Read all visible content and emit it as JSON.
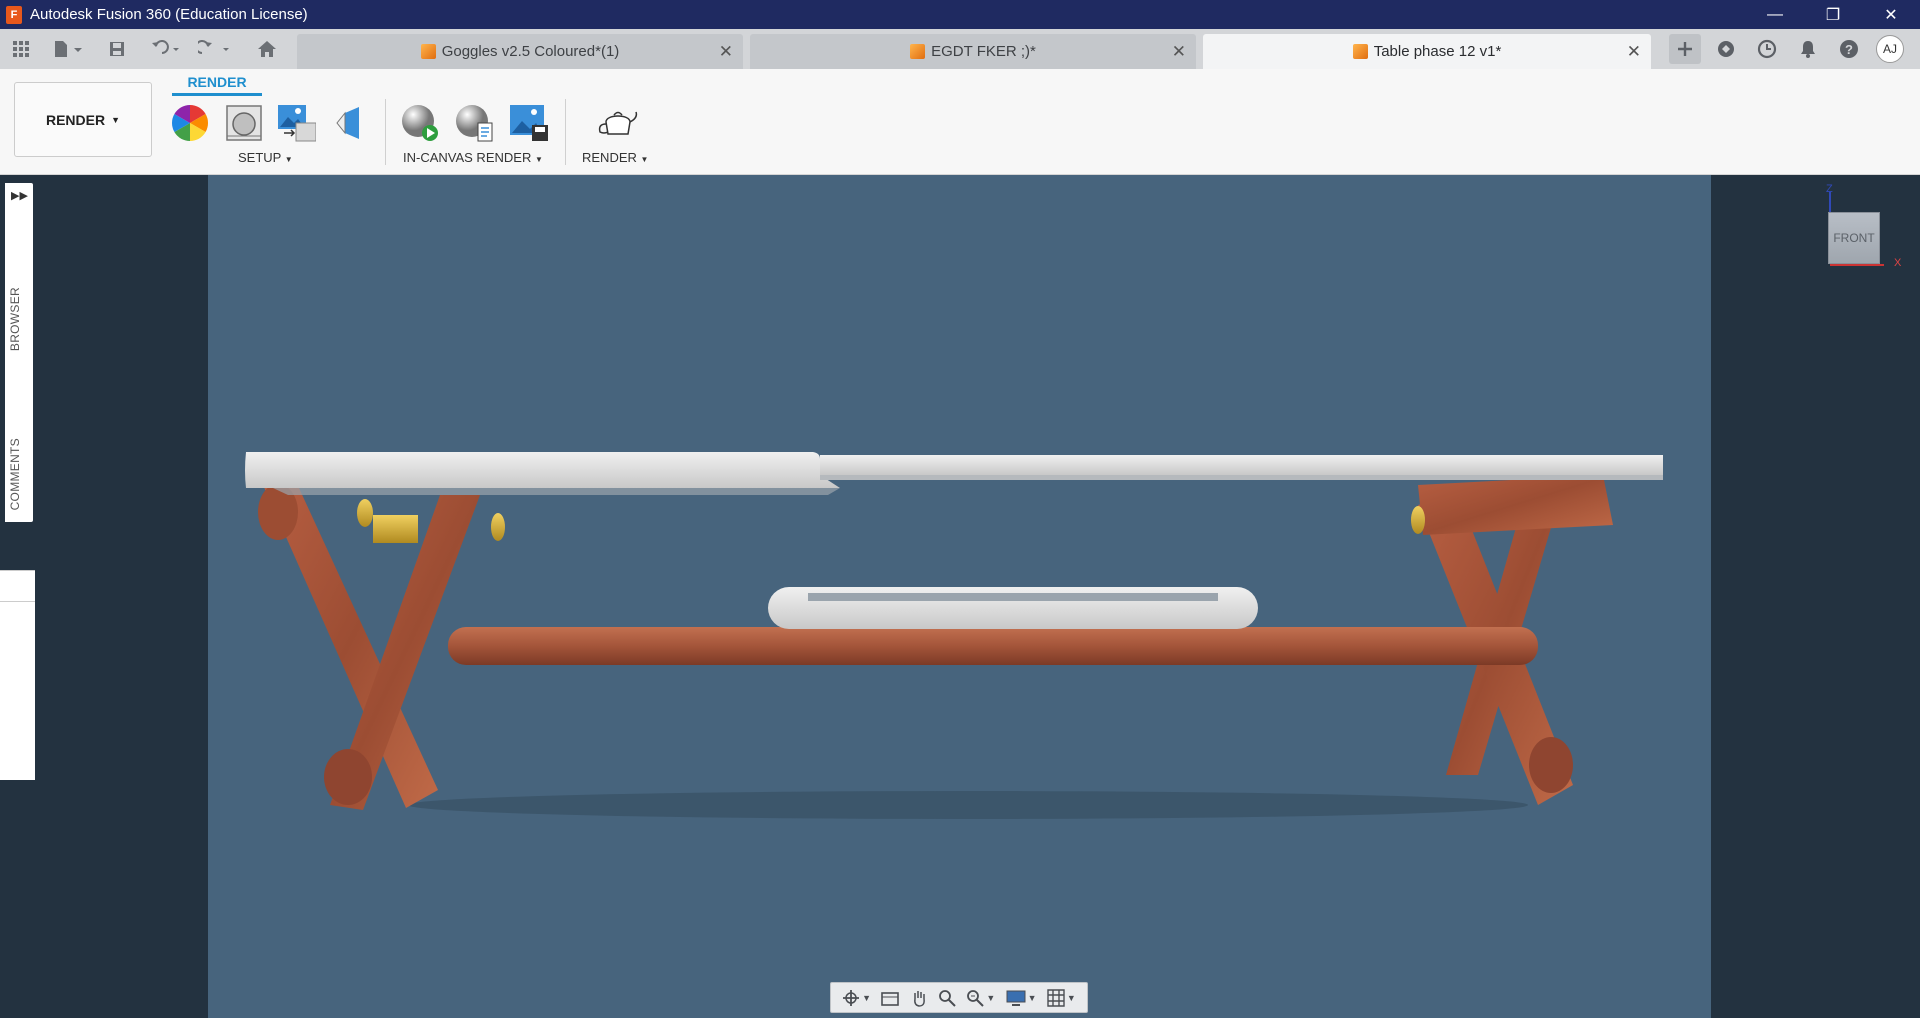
{
  "titlebar": {
    "title": "Autodesk Fusion 360 (Education License)",
    "logo_letter": "F",
    "controls": [
      "—",
      "❐",
      "✕"
    ]
  },
  "tabs": [
    {
      "label": "Goggles v2.5 Coloured*(1)",
      "active": false
    },
    {
      "label": "EGDT FKER ;)*",
      "active": false
    },
    {
      "label": "Table phase 12 v1*",
      "active": true
    }
  ],
  "user": {
    "initials": "AJ"
  },
  "ribbon": {
    "workspace": "RENDER",
    "active_tab": "RENDER",
    "groups": {
      "setup": "SETUP",
      "in_canvas": "IN-CANVAS RENDER",
      "render": "RENDER"
    }
  },
  "left_strip": {
    "browser": "BROWSER",
    "comments": "COMMENTS"
  },
  "viewcube": {
    "face": "FRONT",
    "axis_x": "X",
    "axis_z": "Z"
  },
  "colors": {
    "title_bar": "#1f2a61",
    "accent": "#1f8fce",
    "viewport_bg": "#47647d",
    "wood": "#a9553a",
    "tabletop": "#dcdcdc",
    "brass": "#d4af37"
  },
  "icons": {
    "appearance": "color-wheel-icon",
    "scene": "scene-settings-icon",
    "texture": "texture-map-icon",
    "decal": "decal-icon",
    "start_render": "start-render-icon",
    "render_settings": "render-settings-icon",
    "capture": "capture-image-icon",
    "teapot": "teapot-render-icon"
  }
}
